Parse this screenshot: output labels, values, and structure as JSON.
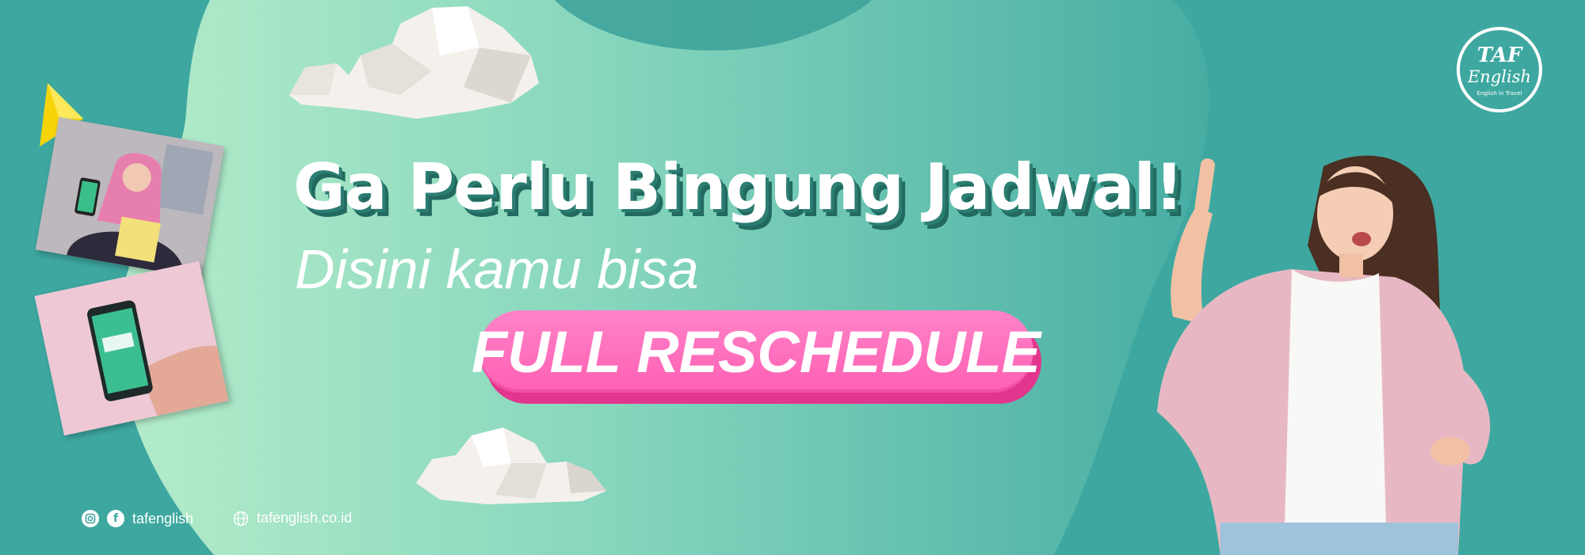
{
  "headline": "Ga Perlu Bingung Jadwal!",
  "subheadline": "Disini kamu bisa",
  "cta": {
    "label": "FULL RESCHEDULE"
  },
  "logo": {
    "line1": "TAF",
    "line2": "English",
    "tagline": "English in Travel"
  },
  "footer": {
    "social_handle": "tafenglish",
    "website": "tafenglish.co.id",
    "icons": [
      "instagram-icon",
      "facebook-icon",
      "globe-icon"
    ]
  },
  "colors": {
    "background": "#3ea8a0",
    "blob_light": "#a8e6c4",
    "cta_pink": "#ff5fb3",
    "headline_shadow": "#2c7d72"
  }
}
